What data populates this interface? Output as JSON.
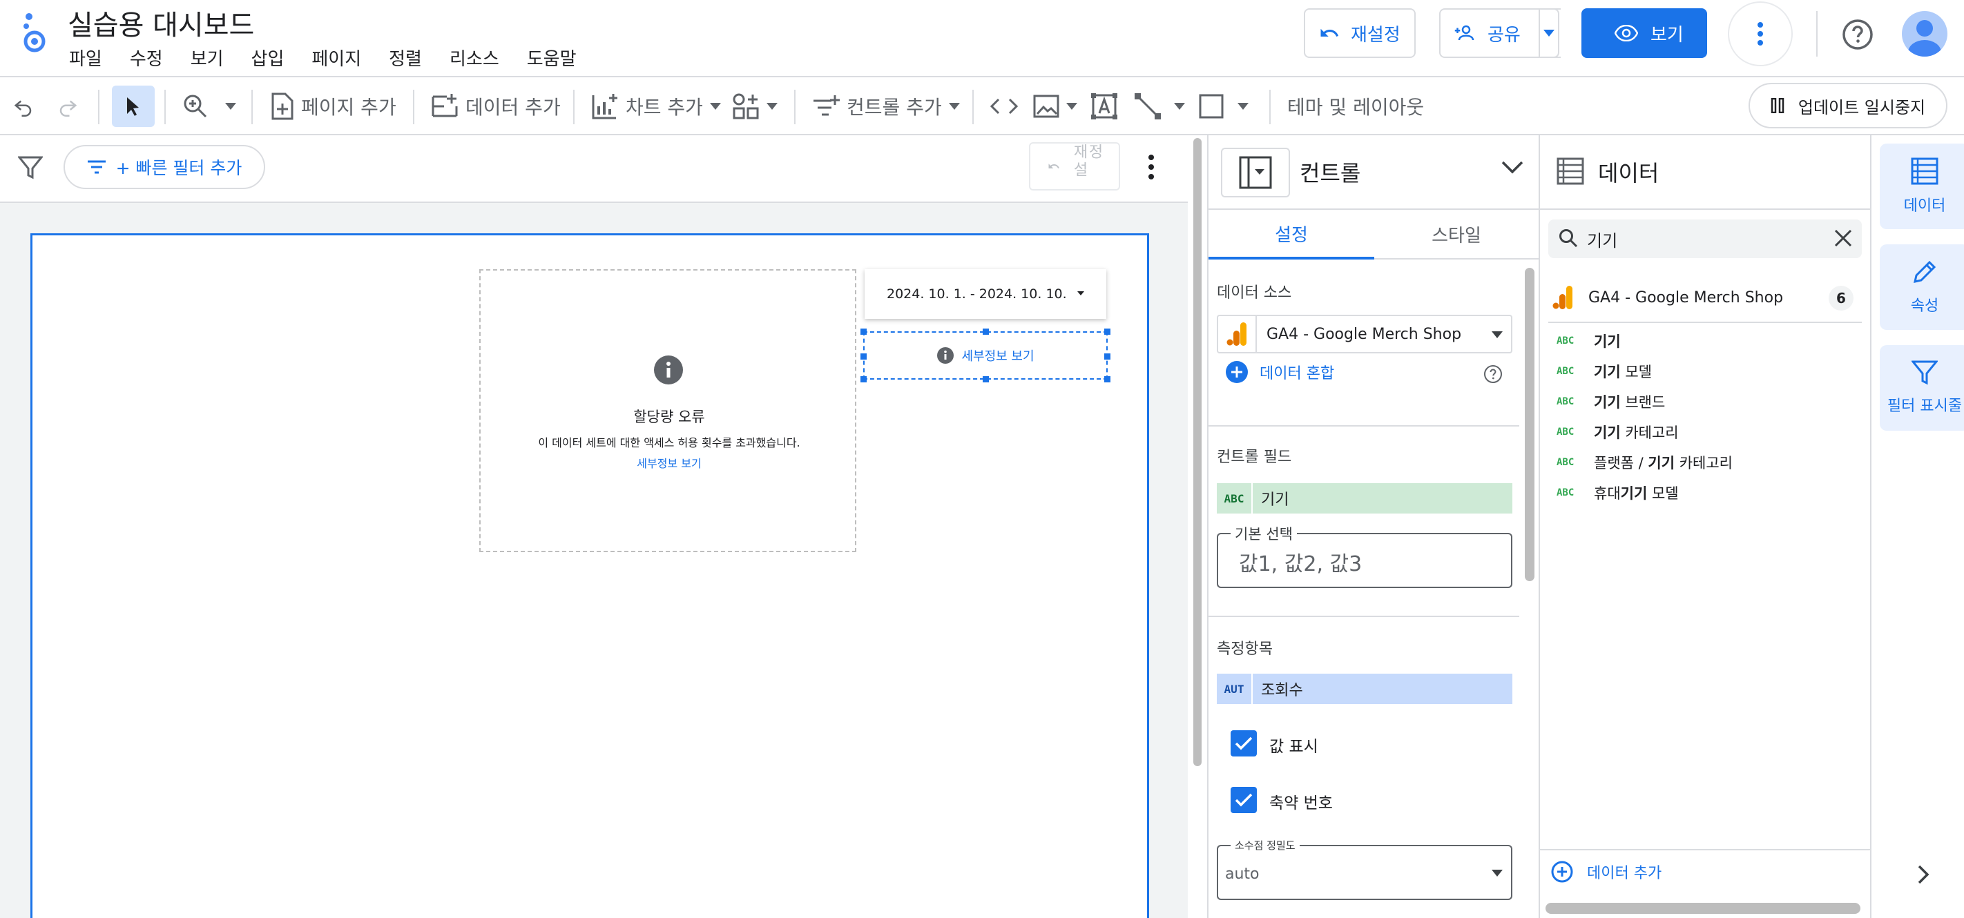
{
  "app": {
    "title": "실습용 대시보드",
    "menu": [
      "파일",
      "수정",
      "보기",
      "삽입",
      "페이지",
      "정렬",
      "리소스",
      "도움말"
    ]
  },
  "header": {
    "reset_label": "재설정",
    "share_label": "공유",
    "view_label": "보기"
  },
  "toolbar": {
    "add_page": "페이지 추가",
    "add_data": "데이터 추가",
    "add_chart": "차트 추가",
    "add_control": "컨트롤 추가",
    "theme_layout": "테마 및 레이아웃",
    "pause_updates": "업데이트 일시중지"
  },
  "filter_bar": {
    "quick_filter": "+ 빠른 필터 추가",
    "reset": "재설정"
  },
  "canvas": {
    "error_title": "할당량 오류",
    "error_message": "이 데이터 세트에 대한 액세스 허용 횟수를 초과했습니다.",
    "error_details_link": "세부정보 보기",
    "date_range": "2024. 10. 1. - 2024. 10. 10.",
    "selected_control_link": "세부정보 보기"
  },
  "properties": {
    "title": "컨트롤",
    "tabs": [
      "설정",
      "스타일"
    ],
    "data_source_label": "데이터 소스",
    "data_source_value": "GA4 - Google Merch Shop",
    "blend_data": "데이터 혼합",
    "control_field_label": "컨트롤 필드",
    "control_field_tag": "ABC",
    "control_field_value": "기기",
    "default_selection_label": "기본 선택",
    "default_selection_placeholder": "값1, 값2, 값3",
    "metric_label": "측정항목",
    "metric_tag": "AUT",
    "metric_value": "조회수",
    "show_values_label": "값 표시",
    "show_values_checked": true,
    "compact_numbers_label": "축약 번호",
    "compact_numbers_checked": true,
    "decimal_precision_label": "소수점 정밀도",
    "decimal_precision_value": "auto"
  },
  "data_panel": {
    "title": "데이터",
    "search_value": "기기",
    "source_name": "GA4 - Google Merch Shop",
    "source_count": "6",
    "field_tag": "ABC",
    "fields": [
      {
        "pre": "",
        "match": "기기",
        "post": ""
      },
      {
        "pre": "",
        "match": "기기",
        "post": " 모델"
      },
      {
        "pre": "",
        "match": "기기",
        "post": " 브랜드"
      },
      {
        "pre": "",
        "match": "기기",
        "post": " 카테고리"
      },
      {
        "pre": "플랫폼 / ",
        "match": "기기",
        "post": " 카테고리"
      },
      {
        "pre": "휴대",
        "match": "기기",
        "post": " 모델"
      }
    ],
    "add_data": "데이터 추가"
  },
  "side_rail": {
    "data": "데이터",
    "properties": "속성",
    "filter_bar": "필터 표시줄"
  },
  "colors": {
    "accent": "#1a73e8",
    "dimension_chip": "#ceead6",
    "metric_chip": "#c6dafc",
    "panel_tab_active": "#1a73e8"
  }
}
